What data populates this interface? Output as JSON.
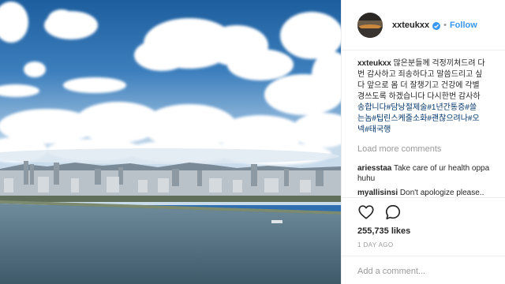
{
  "post": {
    "image_description_icon": "photo-han-river-skyline"
  },
  "header": {
    "username": "xxteukxx",
    "separator": "•",
    "follow_label": "Follow",
    "verified_icon": "verified-badge-icon"
  },
  "caption": {
    "username": "xxteukxx",
    "lines": [
      "많은분들께 걱정끼쳐드려 다",
      "번 감사하고 죄송하다고 말씀드리고 싶",
      "다 앞으로 몸 더 잘챙기고 건강에 각별",
      "경쓰도록 하겠습니다 다시한번 감사하",
      "송합니다#담낭절제술#1년간통증#쓸",
      "는놈#팁린스케줄소화#괜찮으려나#오",
      "넥#태국행"
    ]
  },
  "comments": {
    "load_more_label": "Load more comments",
    "items": [
      {
        "username": "ariesstaa",
        "text": "Take care of ur health oppa",
        "continuation": "huhu"
      },
      {
        "username": "myallisinsi",
        "text": "Don't apologize please.."
      }
    ]
  },
  "actions": {
    "like_icon": "heart-icon",
    "comment_icon": "comment-bubble-icon"
  },
  "likes": {
    "label": "255,735 likes"
  },
  "timestamp": {
    "label": "1 DAY AGO"
  },
  "comment_input": {
    "placeholder": "Add a comment..."
  },
  "colors": {
    "link_blue": "#3897f0",
    "hashtag_blue": "#003569",
    "muted_gray": "#999999",
    "text": "#262626",
    "border": "#efefef"
  }
}
